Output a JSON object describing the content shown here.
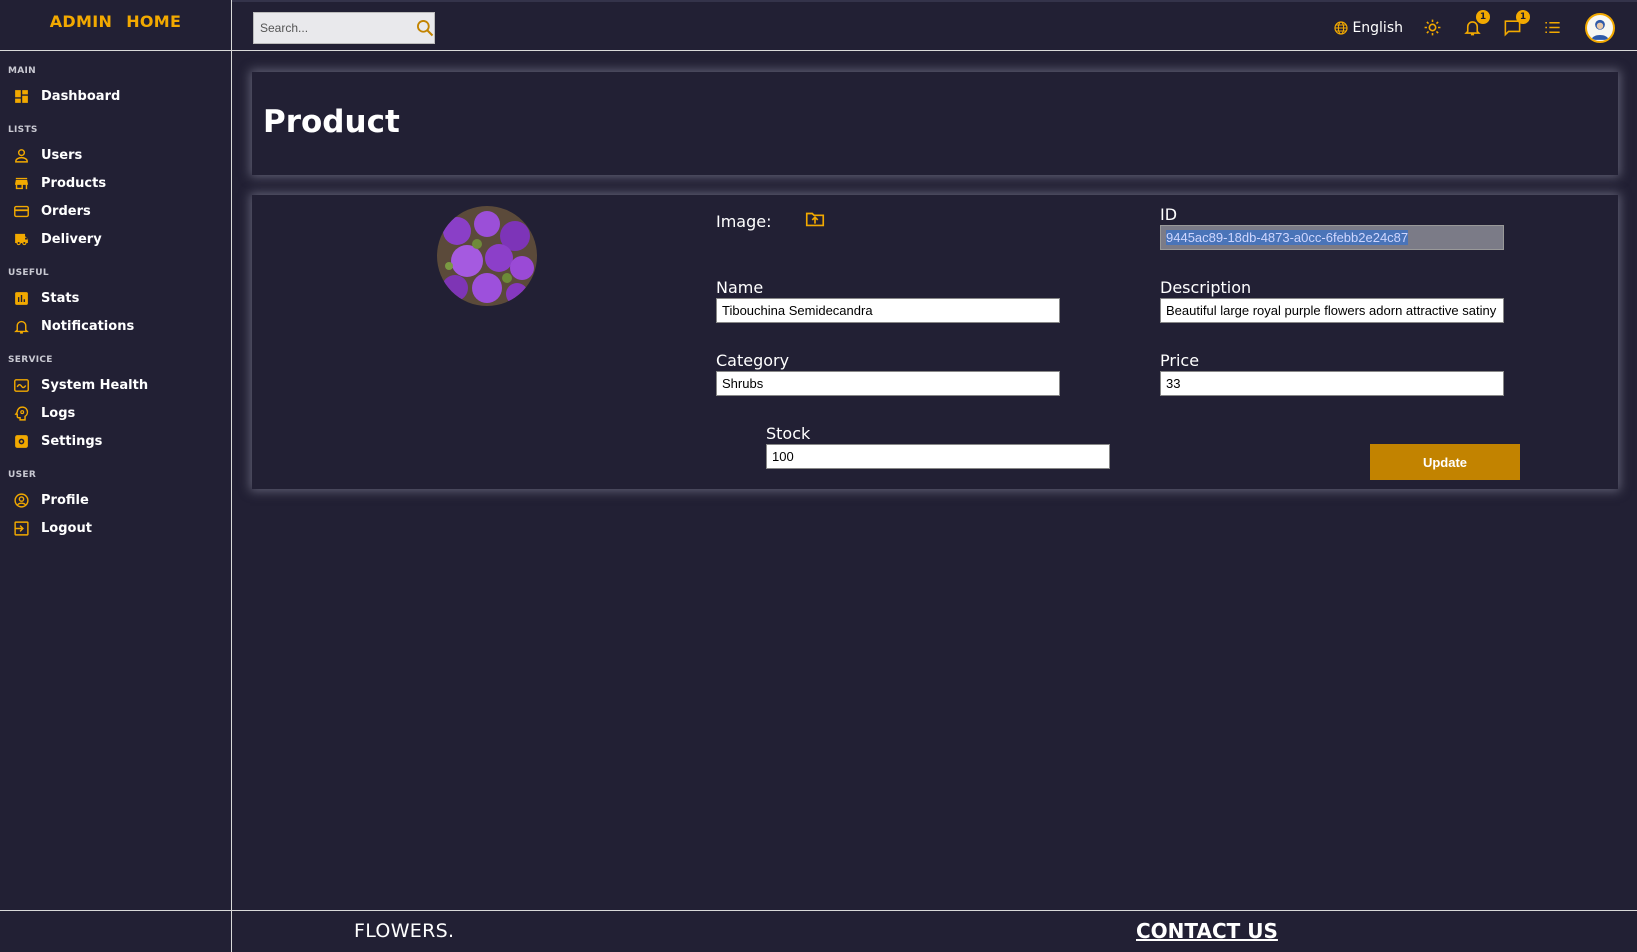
{
  "brand": {
    "left": "ADMIN",
    "right": "HOME"
  },
  "sidebar": {
    "sections": [
      {
        "title": "MAIN",
        "items": [
          {
            "label": "Dashboard",
            "icon": "dashboard-icon"
          }
        ]
      },
      {
        "title": "LISTS",
        "items": [
          {
            "label": "Users",
            "icon": "user-icon"
          },
          {
            "label": "Products",
            "icon": "store-icon"
          },
          {
            "label": "Orders",
            "icon": "credit-card-icon"
          },
          {
            "label": "Delivery",
            "icon": "truck-icon"
          }
        ]
      },
      {
        "title": "USEFUL",
        "items": [
          {
            "label": "Stats",
            "icon": "bar-chart-icon"
          },
          {
            "label": "Notifications",
            "icon": "bell-icon"
          }
        ]
      },
      {
        "title": "SERVICE",
        "items": [
          {
            "label": "System Health",
            "icon": "health-icon"
          },
          {
            "label": "Logs",
            "icon": "psychology-icon"
          },
          {
            "label": "Settings",
            "icon": "settings-icon"
          }
        ]
      },
      {
        "title": "USER",
        "items": [
          {
            "label": "Profile",
            "icon": "account-circle-icon"
          },
          {
            "label": "Logout",
            "icon": "logout-icon"
          }
        ]
      }
    ]
  },
  "topbar": {
    "search_placeholder": "Search...",
    "language": "English",
    "notifications_count": "1",
    "messages_count": "1"
  },
  "page": {
    "title": "Product"
  },
  "form": {
    "image_label": "Image:",
    "id_label": "ID",
    "id_value": "9445ac89-18db-4873-a0cc-6febb2e24c87",
    "name_label": "Name",
    "name_value": "Tibouchina Semidecandra",
    "description_label": "Description",
    "description_value": "Beautiful large royal purple flowers adorn attractive satiny g",
    "category_label": "Category",
    "category_value": "Shrubs",
    "price_label": "Price",
    "price_value": "33",
    "stock_label": "Stock",
    "stock_value": "100",
    "update_label": "Update"
  },
  "footer": {
    "brand": "FLOWERS.",
    "contact": "CONTACT US"
  },
  "colors": {
    "accent": "#f2a900",
    "background": "#222034",
    "button": "#c28300"
  }
}
